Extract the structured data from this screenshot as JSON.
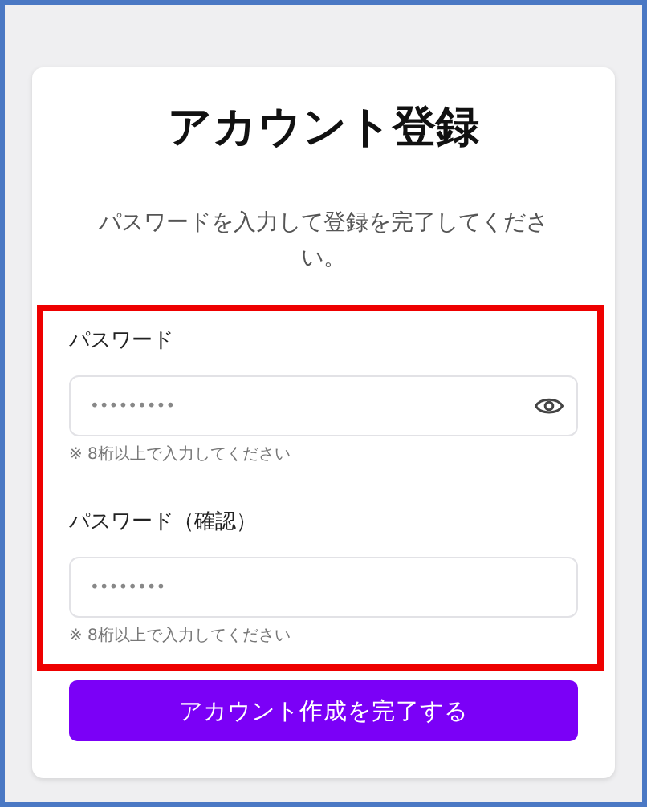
{
  "title": "アカウント登録",
  "subtitle": "パスワードを入力して登録を完了してください。",
  "form_highlighted": true,
  "fields": [
    {
      "label": "パスワード",
      "placeholder": "•••••••••",
      "reveal_toggle": true,
      "hint": "※ 8桁以上で入力してください"
    },
    {
      "label": "パスワード（確認）",
      "placeholder": "••••••••",
      "reveal_toggle": false,
      "hint": "※ 8桁以上で入力してください"
    }
  ],
  "submit_button": "アカウント作成を完了する"
}
